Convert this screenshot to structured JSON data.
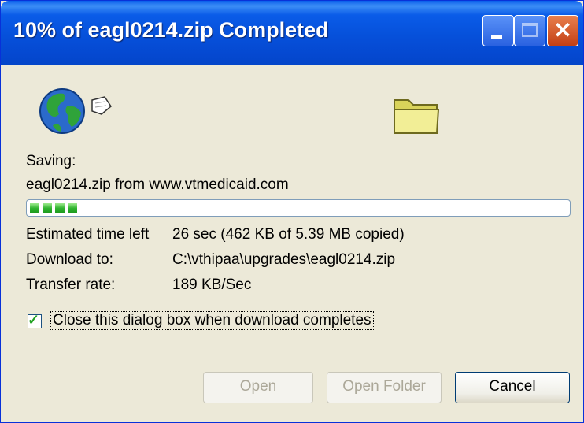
{
  "window": {
    "title": "10% of eagl0214.zip Completed"
  },
  "icons": {
    "globe": "globe-icon",
    "folder": "folder-icon"
  },
  "download": {
    "saving_label": "Saving:",
    "source": "eagl0214.zip from www.vtmedicaid.com",
    "progress_percent": 10,
    "estimated_label": "Estimated time left",
    "estimated_value": "26 sec (462 KB of 5.39 MB copied)",
    "download_to_label": "Download to:",
    "download_to_value": "C:\\vthipaa\\upgrades\\eagl0214.zip",
    "transfer_rate_label": "Transfer rate:",
    "transfer_rate_value": "189 KB/Sec"
  },
  "options": {
    "close_on_complete_label": "Close this dialog box when download completes",
    "close_on_complete_checked": true
  },
  "buttons": {
    "open_label": "Open",
    "open_folder_label": "Open Folder",
    "cancel_label": "Cancel"
  }
}
